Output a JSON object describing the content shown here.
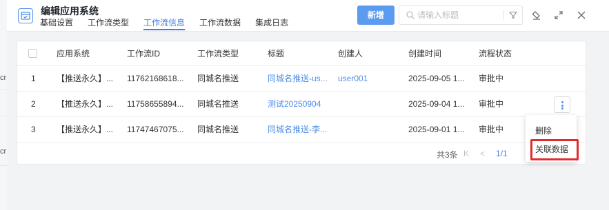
{
  "background": {
    "left_fragments": [
      "cr",
      "cr"
    ]
  },
  "header": {
    "title": "编辑应用系统",
    "tabs": [
      {
        "label": "基础设置",
        "active": false
      },
      {
        "label": "工作流类型",
        "active": false
      },
      {
        "label": "工作流信息",
        "active": true
      },
      {
        "label": "工作流数据",
        "active": false
      },
      {
        "label": "集成日志",
        "active": false
      }
    ],
    "add_button": "新增",
    "search_placeholder": "请输入标题",
    "search_value": ""
  },
  "table": {
    "columns": [
      "应用系统",
      "工作流ID",
      "工作流类型",
      "标题",
      "创建人",
      "创建时间",
      "流程状态"
    ],
    "rows": [
      {
        "index": "1",
        "app": "【推送永久】...",
        "wf_id": "11762168618...",
        "wf_type": "同城名推送",
        "title": "同城名推送-us...",
        "creator": "user001",
        "created": "2025-09-05 1...",
        "status": "审批中"
      },
      {
        "index": "2",
        "app": "【推送永久】...",
        "wf_id": "11758655894...",
        "wf_type": "同城名推送",
        "title": "测试20250904",
        "creator": "",
        "created": "2025-09-04 1...",
        "status": "审批中"
      },
      {
        "index": "3",
        "app": "【推送永久】...",
        "wf_id": "11747467075...",
        "wf_type": "同城名推送",
        "title": "同城名推送-李...",
        "creator": "",
        "created": "2025-09-01 1...",
        "status": "审批中"
      }
    ]
  },
  "pagination": {
    "total": "共3条",
    "first": "K",
    "prev": "<",
    "current": "1/1"
  },
  "dropdown": {
    "items": [
      "删除",
      "关联数据"
    ]
  },
  "colors": {
    "accent": "#3d7de8",
    "add_button": "#5b9cf0",
    "highlight_box": "#e32b2b"
  }
}
